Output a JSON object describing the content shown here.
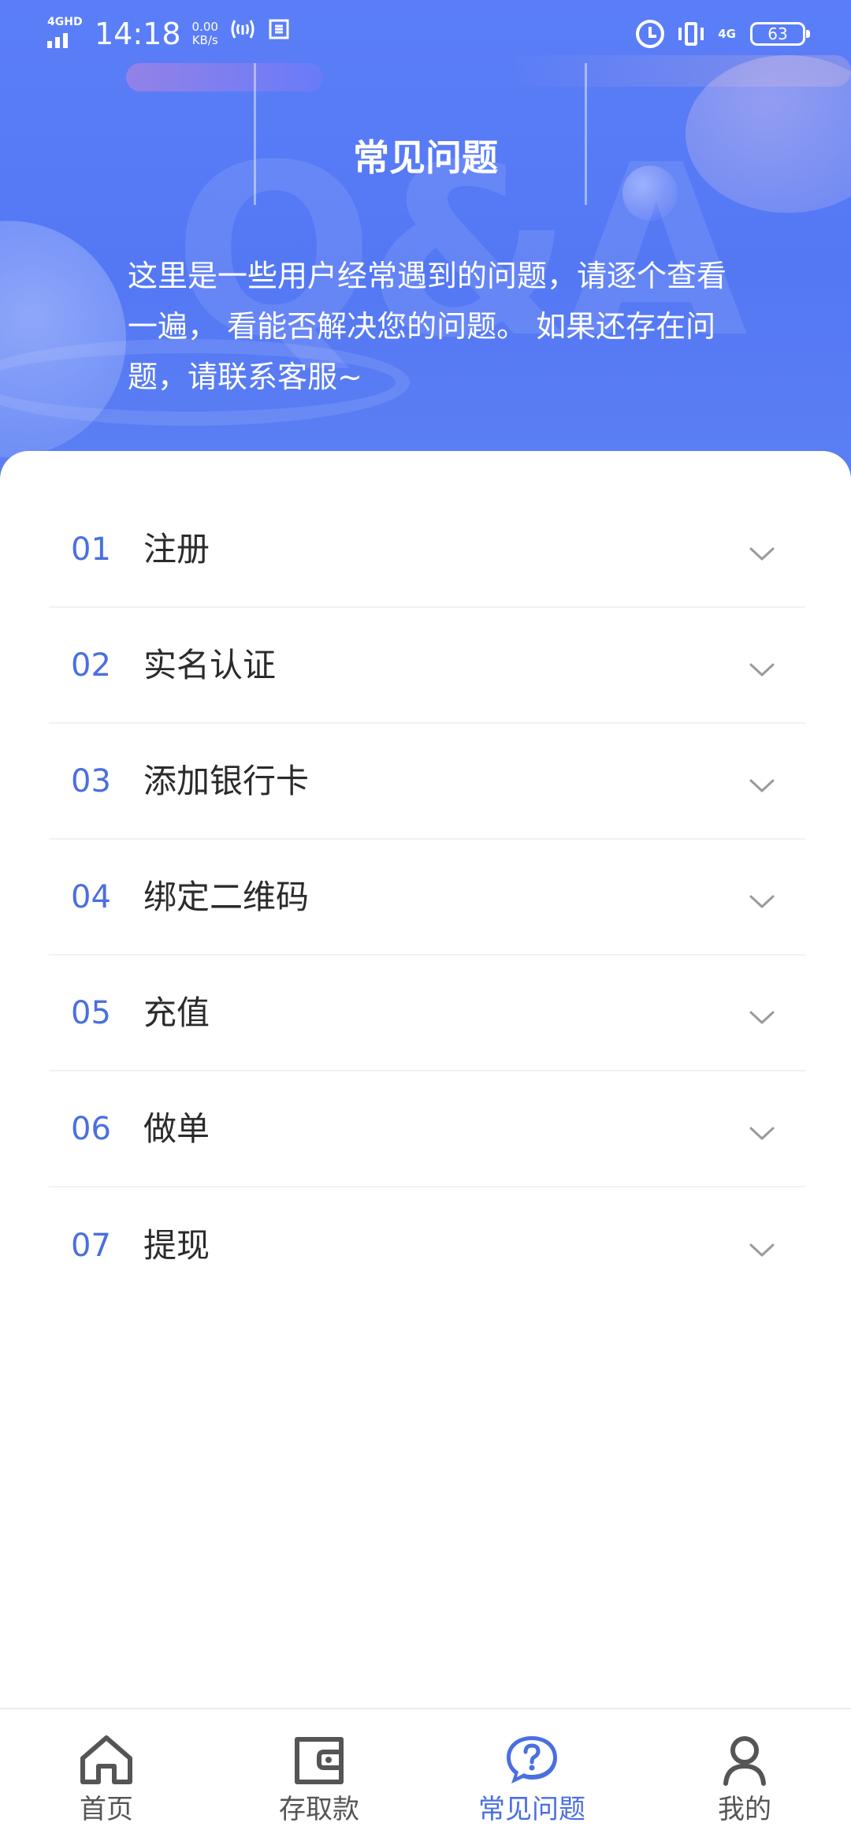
{
  "status_bar": {
    "network_type": "4GHD",
    "time": "14:18",
    "speed_value": "0.00",
    "speed_unit": "KB/s",
    "net_right": "4G",
    "battery": "63"
  },
  "header": {
    "title": "常见问题",
    "intro": "这里是一些用户经常遇到的问题，请逐个查看一遍， 看能否解决您的问题。 如果还存在问题，请联系客服~",
    "watermark_text": "Q&A"
  },
  "faq": {
    "items": [
      {
        "number": "01",
        "title": "注册"
      },
      {
        "number": "02",
        "title": "实名认证"
      },
      {
        "number": "03",
        "title": "添加银行卡"
      },
      {
        "number": "04",
        "title": "绑定二维码"
      },
      {
        "number": "05",
        "title": "充值"
      },
      {
        "number": "06",
        "title": "做单"
      },
      {
        "number": "07",
        "title": "提现"
      }
    ]
  },
  "nav": {
    "items": [
      {
        "label": "首页",
        "icon": "home-icon",
        "active": false
      },
      {
        "label": "存取款",
        "icon": "wallet-icon",
        "active": false
      },
      {
        "label": "常见问题",
        "icon": "question-bubble-icon",
        "active": true
      },
      {
        "label": "我的",
        "icon": "user-icon",
        "active": false
      }
    ]
  },
  "colors": {
    "header_blue": "#5478f4",
    "accent_blue": "#4a6fe0",
    "text_dark": "#2b2b2b",
    "nav_inactive": "#555555"
  }
}
